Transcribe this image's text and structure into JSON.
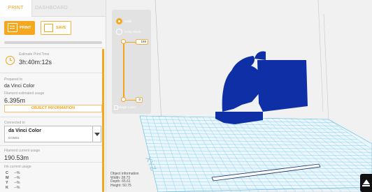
{
  "tabs": [
    {
      "label": "PRINT"
    },
    {
      "label": "DASHBOARD"
    }
  ],
  "toolbar": {
    "print_label": "PRINT",
    "save_label": "SAVE"
  },
  "progress": {
    "fraction": 0.0
  },
  "estimate": {
    "label": "Estimate Print Time",
    "value": "3h:40m:12s"
  },
  "prepared": {
    "label": "Prepared to",
    "value": "da Vinci Color"
  },
  "filament_estimated": {
    "label": "Filament estimated usage",
    "value": "6.395m"
  },
  "object_info_button": "OBJECT INFORMATION",
  "connection": {
    "label": "Connected to",
    "printer": "da Vinci Color",
    "port": "COM81"
  },
  "filament_current": {
    "label": "Filament current usage",
    "value": "190.53m"
  },
  "ink": {
    "label": "Ink current usage",
    "rows": [
      {
        "channel": "C",
        "value": "--%"
      },
      {
        "channel": "M",
        "value": "--%"
      },
      {
        "channel": "Y",
        "value": "--%"
      },
      {
        "channel": "K",
        "value": "--%"
      }
    ]
  },
  "layer_view": {
    "mode_solid": "Solid",
    "mode_shell": "X-ray Mode",
    "top_layer": "169",
    "bottom_layer": "0",
    "single_layer": "Single Layer"
  },
  "object_information": {
    "title": "Object information",
    "width": "Width: 28.73",
    "depth": "Depth: 65.61",
    "height": "Height: 50.75"
  },
  "colors": {
    "accent": "#f6a720",
    "bed_grid": "#6fc8ea",
    "model": "#0f2fa6"
  }
}
